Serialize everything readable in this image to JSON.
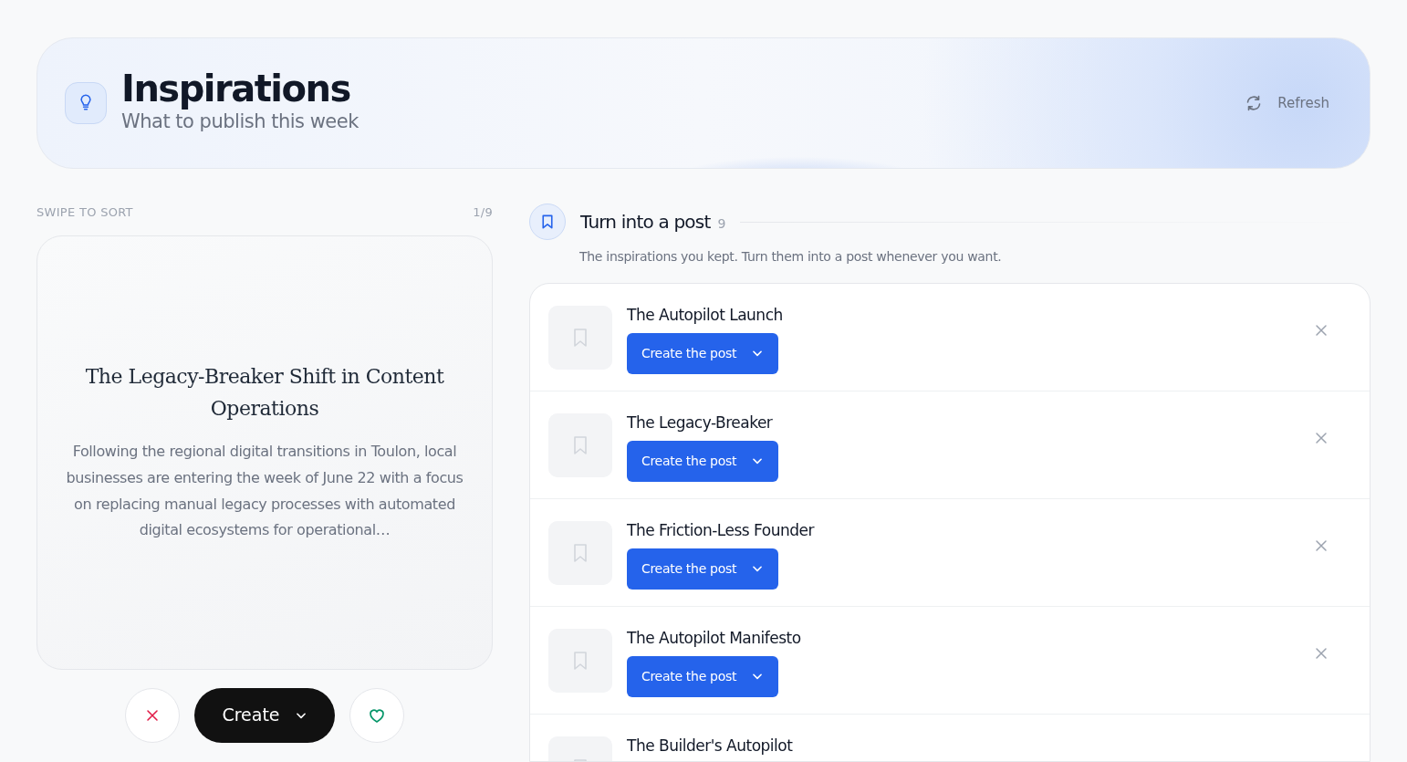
{
  "header": {
    "title": "Inspirations",
    "subtitle": "What to publish this week",
    "refresh": "Refresh"
  },
  "swipe": {
    "label": "SWIPE TO SORT",
    "counter": "1/9",
    "card": {
      "title": "The Legacy-Breaker Shift in Content Operations",
      "body": "Following the regional digital transitions in Toulon, local businesses are entering the week of June 22 with a focus on replacing manual legacy processes with automated digital ecosystems for operational…"
    },
    "create": "Create"
  },
  "kept": {
    "title": "Turn into a post",
    "count": "9",
    "description": "The inspirations you kept. Turn them into a post whenever you want.",
    "items": [
      {
        "title": "The Autopilot Launch",
        "button": "Create the post"
      },
      {
        "title": "The Legacy-Breaker",
        "button": "Create the post"
      },
      {
        "title": "The Friction-Less Founder",
        "button": "Create the post"
      },
      {
        "title": "The Autopilot Manifesto",
        "button": "Create the post"
      },
      {
        "title": "The Builder's Autopilot"
      }
    ]
  }
}
